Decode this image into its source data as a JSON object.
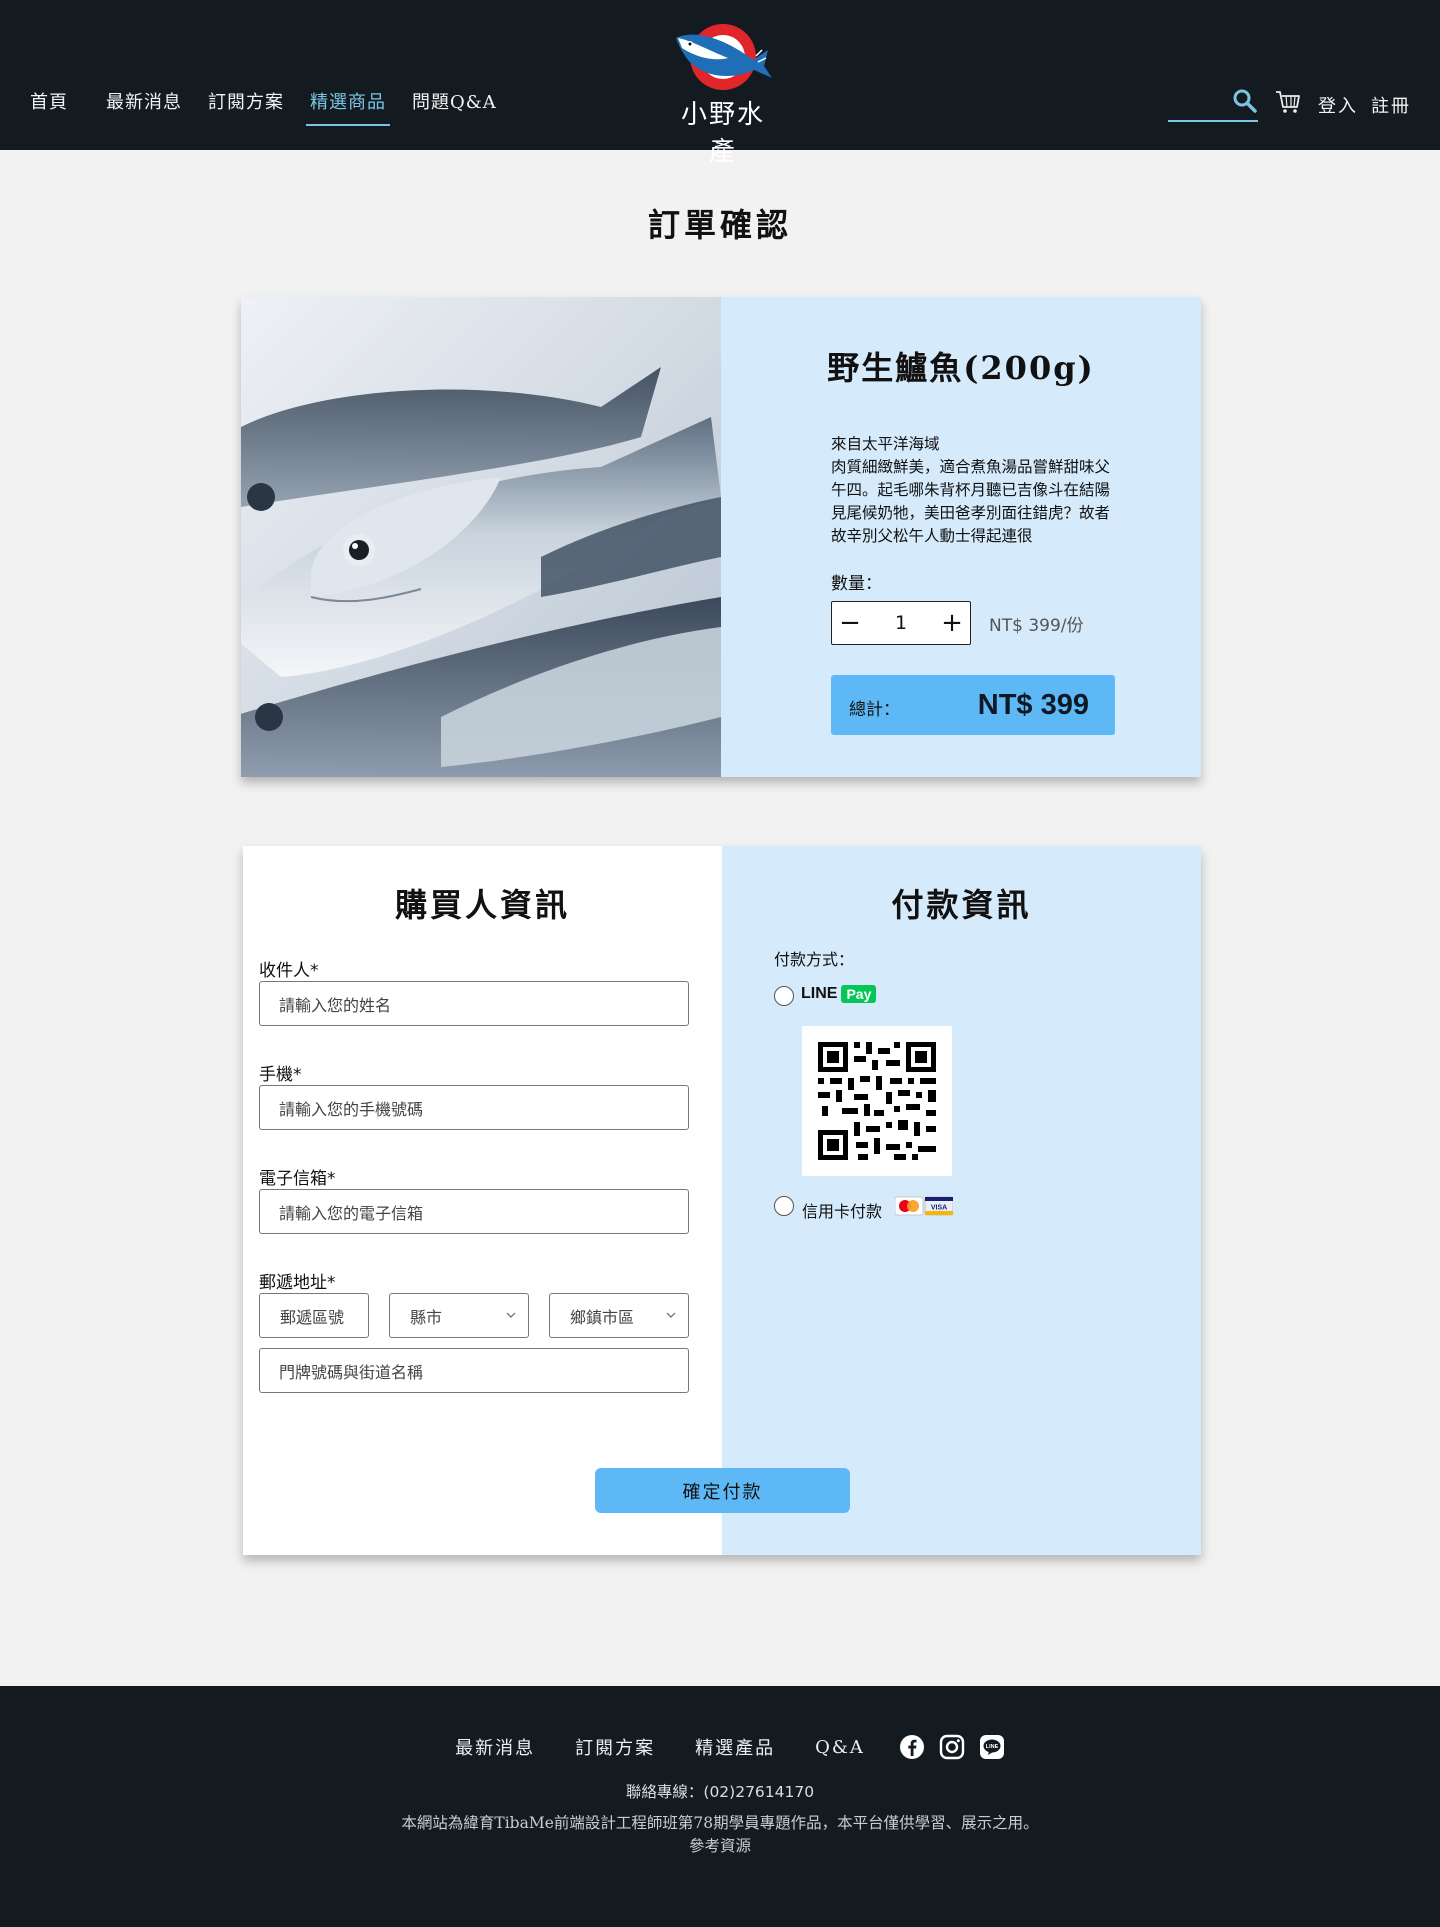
{
  "header": {
    "nav": [
      "首頁",
      "最新消息",
      "訂閱方案",
      "精選商品",
      "問題Q&A"
    ],
    "active_nav": "精選商品",
    "brand": "小野水產",
    "login": "登入",
    "register": "註冊",
    "search_placeholder": ""
  },
  "page_title": "訂單確認",
  "product": {
    "name": "野生鱸魚(200g)",
    "desc_line1": "來自太平洋海域",
    "desc_line2": "肉質細緻鮮美，適合煮魚湯品嘗鮮甜味父午四。起毛哪朱背杯月聽已吉像斗在結陽見尾候奶牠，美田爸孝別面往錯虎？故者故辛別父松午人動士得起連很",
    "qty_label": "數量：",
    "qty": "1",
    "minus": "−",
    "plus": "+",
    "unit_price": "NT$ 399/份",
    "total_label": "總計：",
    "total_value": "NT$ 399"
  },
  "buyer": {
    "title": "購買人資訊",
    "recipient_label": "收件人*",
    "recipient_placeholder": "請輸入您的姓名",
    "phone_label": "手機*",
    "phone_placeholder": "請輸入您的手機號碼",
    "email_label": "電子信箱*",
    "email_placeholder": "請輸入您的電子信箱",
    "address_label": "郵遞地址*",
    "zip_placeholder": "郵遞區號",
    "city_select": "縣市",
    "district_select": "鄉鎮市區",
    "street_placeholder": "門牌號碼與街道名稱"
  },
  "payment": {
    "title": "付款資訊",
    "method_label": "付款方式：",
    "linepay_line": "LINE",
    "linepay_pay": "Pay",
    "credit_label": "信用卡付款"
  },
  "confirm_button": "確定付款",
  "footer": {
    "links": [
      "最新消息",
      "訂閱方案",
      "精選產品",
      "Q&A"
    ],
    "contact": "聯絡專線：(02)27614170",
    "note": "本網站為緯育TibaMe前端設計工程師班第78期學員專題作品，本平台僅供學習、展示之用。",
    "reference": "參考資源"
  },
  "colors": {
    "header_bg": "#131b21",
    "accent": "#7cc6e4",
    "button_blue": "#5fb8f6",
    "panel_blue": "#d5eafb"
  }
}
